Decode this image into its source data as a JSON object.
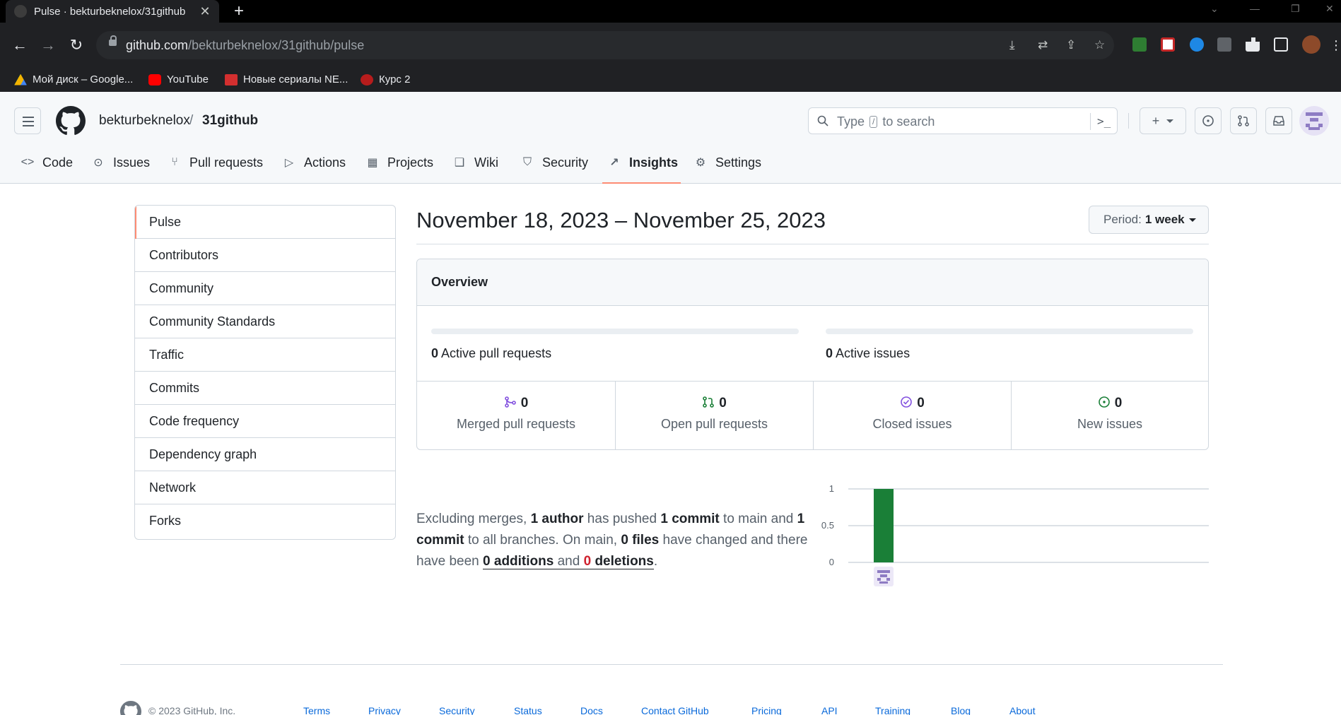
{
  "browser": {
    "tab_title": "Pulse · bekturbeknelox/31github",
    "tab_close": "✕",
    "new_tab": "+",
    "url_host": "github.com",
    "url_path": "/bekturbeknelox/31github/pulse",
    "bookmarks": [
      "Мой диск – Google...",
      "YouTube",
      "Новые сериалы NE...",
      "Курс 2"
    ]
  },
  "header": {
    "owner": "bekturbeknelox",
    "separator": "/",
    "repo": "31github",
    "search_before": "Type",
    "search_key": "/",
    "search_after": "to search"
  },
  "repo_nav": [
    "Code",
    "Issues",
    "Pull requests",
    "Actions",
    "Projects",
    "Wiki",
    "Security",
    "Insights",
    "Settings"
  ],
  "sidebar": [
    "Pulse",
    "Contributors",
    "Community",
    "Community Standards",
    "Traffic",
    "Commits",
    "Code frequency",
    "Dependency graph",
    "Network",
    "Forks"
  ],
  "main": {
    "date_range": "November 18, 2023 – November 25, 2023",
    "period_label": "Period:",
    "period_value": "1 week",
    "overview_title": "Overview",
    "active_pr_count": "0",
    "active_pr_label": "Active pull requests",
    "active_pr_progress": 0,
    "active_issues_count": "0",
    "active_issues_label": "Active issues",
    "active_issues_progress": 0,
    "stats": [
      {
        "count": "0",
        "label": "Merged pull requests",
        "color": "#8250df"
      },
      {
        "count": "0",
        "label": "Open pull requests",
        "color": "#1a7f37"
      },
      {
        "count": "0",
        "label": "Closed issues",
        "color": "#8250df"
      },
      {
        "count": "0",
        "label": "New issues",
        "color": "#1a7f37"
      }
    ],
    "summary": {
      "t1": "Excluding merges, ",
      "authors": "1 author",
      "t2": " has pushed ",
      "commits_main": "1 commit",
      "t3": " to main and ",
      "commits_all": "1 commit",
      "t4": " to all branches. On main, ",
      "files": "0 files",
      "t5": " have changed and there have been ",
      "additions": "0 additions",
      "t6": " and ",
      "deletions_num": "0",
      "deletions_word": " deletions",
      "t7": "."
    }
  },
  "chart_data": {
    "type": "bar",
    "categories": [
      "contributor"
    ],
    "values": [
      1
    ],
    "ylim": [
      0,
      1
    ],
    "yticks": [
      "1",
      "0.5",
      "0"
    ],
    "bar_color": "#1a7f37",
    "grid": true
  },
  "footer": {
    "copyright": "© 2023 GitHub, Inc.",
    "links": [
      "Terms",
      "Privacy",
      "Security",
      "Status",
      "Docs",
      "Contact GitHub",
      "Pricing",
      "API",
      "Training",
      "Blog",
      "About"
    ]
  }
}
